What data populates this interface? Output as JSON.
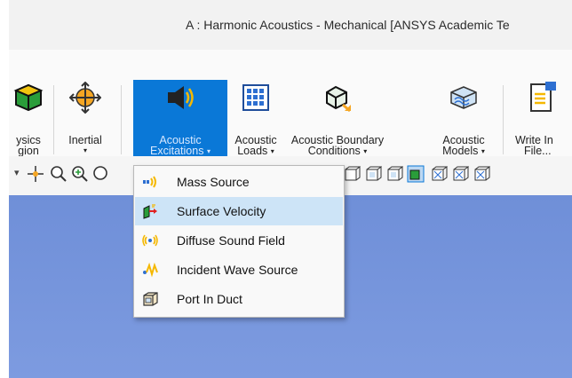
{
  "window": {
    "title": "A : Harmonic Acoustics - Mechanical [ANSYS Academic Te"
  },
  "ribbon": {
    "buttons": [
      {
        "line1": "ysics",
        "line2": "gion",
        "line3": "ysics"
      },
      {
        "line1": "Inertial",
        "line2": "▾"
      },
      {
        "line1": "Acoustic",
        "line2": "Excitations",
        "selected": true
      },
      {
        "line1": "Acoustic",
        "line2": "Loads"
      },
      {
        "line1": "Acoustic Boundary",
        "line2": "Conditions"
      },
      {
        "line1": "Acoustic",
        "line2": "Models"
      },
      {
        "line1": "Write In",
        "line2": "File..."
      }
    ]
  },
  "menu": {
    "items": [
      {
        "label": "Mass Source",
        "icon": "mass-source-icon"
      },
      {
        "label": "Surface Velocity",
        "icon": "surface-velocity-icon",
        "highlighted": true
      },
      {
        "label": "Diffuse Sound Field",
        "icon": "diffuse-sound-field-icon"
      },
      {
        "label": "Incident Wave Source",
        "icon": "incident-wave-icon"
      },
      {
        "label": "Port In Duct",
        "icon": "port-in-duct-icon"
      }
    ]
  },
  "colors": {
    "accent": "#0a78d7",
    "viewport": "#7592dc",
    "menu_highlight": "#cde4f7"
  }
}
